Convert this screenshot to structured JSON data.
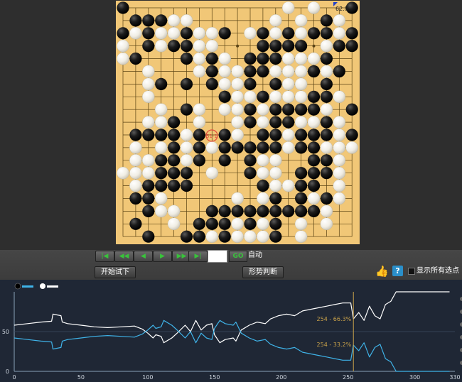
{
  "board": {
    "size": 19,
    "score_badge": "62.8",
    "current_move_marker": "51-1",
    "stones": {
      "black": [
        [
          0,
          0
        ],
        [
          18,
          0
        ],
        [
          1,
          1
        ],
        [
          2,
          1
        ],
        [
          3,
          1
        ],
        [
          16,
          1
        ],
        [
          0,
          2
        ],
        [
          2,
          2
        ],
        [
          5,
          2
        ],
        [
          8,
          2
        ],
        [
          11,
          2
        ],
        [
          13,
          2
        ],
        [
          15,
          2
        ],
        [
          16,
          2
        ],
        [
          18,
          2
        ],
        [
          2,
          3
        ],
        [
          4,
          3
        ],
        [
          5,
          3
        ],
        [
          11,
          3
        ],
        [
          12,
          3
        ],
        [
          13,
          3
        ],
        [
          14,
          3
        ],
        [
          17,
          3
        ],
        [
          18,
          3
        ],
        [
          1,
          4
        ],
        [
          5,
          4
        ],
        [
          7,
          4
        ],
        [
          10,
          4
        ],
        [
          11,
          4
        ],
        [
          12,
          4
        ],
        [
          16,
          4
        ],
        [
          7,
          5
        ],
        [
          10,
          5
        ],
        [
          11,
          5
        ],
        [
          15,
          5
        ],
        [
          17,
          5
        ],
        [
          3,
          6
        ],
        [
          5,
          6
        ],
        [
          7,
          6
        ],
        [
          10,
          6
        ],
        [
          12,
          6
        ],
        [
          16,
          6
        ],
        [
          8,
          7
        ],
        [
          11,
          7
        ],
        [
          15,
          7
        ],
        [
          16,
          7
        ],
        [
          5,
          8
        ],
        [
          10,
          8
        ],
        [
          12,
          8
        ],
        [
          13,
          8
        ],
        [
          14,
          8
        ],
        [
          15,
          8
        ],
        [
          18,
          8
        ],
        [
          4,
          9
        ],
        [
          10,
          9
        ],
        [
          12,
          9
        ],
        [
          13,
          9
        ],
        [
          16,
          9
        ],
        [
          1,
          10
        ],
        [
          2,
          10
        ],
        [
          3,
          10
        ],
        [
          4,
          10
        ],
        [
          6,
          10
        ],
        [
          8,
          10
        ],
        [
          11,
          10
        ],
        [
          12,
          10
        ],
        [
          14,
          10
        ],
        [
          15,
          10
        ],
        [
          16,
          10
        ],
        [
          18,
          10
        ],
        [
          4,
          11
        ],
        [
          6,
          11
        ],
        [
          8,
          11
        ],
        [
          9,
          11
        ],
        [
          10,
          11
        ],
        [
          11,
          11
        ],
        [
          12,
          11
        ],
        [
          14,
          11
        ],
        [
          15,
          11
        ],
        [
          3,
          12
        ],
        [
          4,
          12
        ],
        [
          6,
          12
        ],
        [
          8,
          12
        ],
        [
          10,
          12
        ],
        [
          15,
          12
        ],
        [
          16,
          12
        ],
        [
          3,
          13
        ],
        [
          4,
          13
        ],
        [
          5,
          13
        ],
        [
          10,
          13
        ],
        [
          14,
          13
        ],
        [
          15,
          13
        ],
        [
          16,
          13
        ],
        [
          2,
          14
        ],
        [
          3,
          14
        ],
        [
          4,
          14
        ],
        [
          5,
          14
        ],
        [
          11,
          14
        ],
        [
          14,
          14
        ],
        [
          15,
          14
        ],
        [
          1,
          15
        ],
        [
          2,
          15
        ],
        [
          12,
          15
        ],
        [
          14,
          15
        ],
        [
          16,
          15
        ],
        [
          2,
          16
        ],
        [
          7,
          16
        ],
        [
          8,
          16
        ],
        [
          9,
          16
        ],
        [
          10,
          16
        ],
        [
          11,
          16
        ],
        [
          12,
          16
        ],
        [
          13,
          16
        ],
        [
          14,
          16
        ],
        [
          15,
          16
        ],
        [
          1,
          17
        ],
        [
          6,
          17
        ],
        [
          7,
          17
        ],
        [
          8,
          17
        ],
        [
          10,
          17
        ],
        [
          12,
          17
        ],
        [
          2,
          18
        ],
        [
          5,
          18
        ],
        [
          6,
          18
        ],
        [
          8,
          18
        ],
        [
          12,
          18
        ]
      ],
      "white": [
        [
          13,
          0
        ],
        [
          15,
          0
        ],
        [
          4,
          1
        ],
        [
          5,
          1
        ],
        [
          12,
          1
        ],
        [
          14,
          1
        ],
        [
          17,
          1
        ],
        [
          1,
          2
        ],
        [
          3,
          2
        ],
        [
          4,
          2
        ],
        [
          6,
          2
        ],
        [
          7,
          2
        ],
        [
          10,
          2
        ],
        [
          12,
          2
        ],
        [
          14,
          2
        ],
        [
          17,
          2
        ],
        [
          0,
          3
        ],
        [
          3,
          3
        ],
        [
          6,
          3
        ],
        [
          7,
          3
        ],
        [
          16,
          3
        ],
        [
          0,
          4
        ],
        [
          6,
          4
        ],
        [
          8,
          4
        ],
        [
          13,
          4
        ],
        [
          14,
          4
        ],
        [
          15,
          4
        ],
        [
          2,
          5
        ],
        [
          6,
          5
        ],
        [
          8,
          5
        ],
        [
          9,
          5
        ],
        [
          12,
          5
        ],
        [
          13,
          5
        ],
        [
          14,
          5
        ],
        [
          16,
          5
        ],
        [
          2,
          6
        ],
        [
          8,
          6
        ],
        [
          9,
          6
        ],
        [
          13,
          6
        ],
        [
          14,
          6
        ],
        [
          2,
          7
        ],
        [
          9,
          7
        ],
        [
          10,
          7
        ],
        [
          12,
          7
        ],
        [
          13,
          7
        ],
        [
          14,
          7
        ],
        [
          17,
          7
        ],
        [
          3,
          8
        ],
        [
          6,
          8
        ],
        [
          8,
          8
        ],
        [
          9,
          8
        ],
        [
          11,
          8
        ],
        [
          16,
          8
        ],
        [
          2,
          9
        ],
        [
          3,
          9
        ],
        [
          6,
          9
        ],
        [
          9,
          9
        ],
        [
          11,
          9
        ],
        [
          14,
          9
        ],
        [
          15,
          9
        ],
        [
          17,
          9
        ],
        [
          5,
          10
        ],
        [
          9,
          10
        ],
        [
          13,
          10
        ],
        [
          17,
          10
        ],
        [
          1,
          11
        ],
        [
          3,
          11
        ],
        [
          5,
          11
        ],
        [
          7,
          11
        ],
        [
          13,
          11
        ],
        [
          16,
          11
        ],
        [
          17,
          11
        ],
        [
          18,
          11
        ],
        [
          1,
          12
        ],
        [
          2,
          12
        ],
        [
          5,
          12
        ],
        [
          11,
          12
        ],
        [
          12,
          12
        ],
        [
          17,
          12
        ],
        [
          0,
          13
        ],
        [
          1,
          13
        ],
        [
          2,
          13
        ],
        [
          7,
          13
        ],
        [
          11,
          13
        ],
        [
          12,
          13
        ],
        [
          17,
          13
        ],
        [
          1,
          14
        ],
        [
          12,
          14
        ],
        [
          13,
          14
        ],
        [
          17,
          14
        ],
        [
          3,
          15
        ],
        [
          9,
          15
        ],
        [
          11,
          15
        ],
        [
          15,
          15
        ],
        [
          17,
          15
        ],
        [
          3,
          16
        ],
        [
          4,
          16
        ],
        [
          16,
          16
        ],
        [
          4,
          17
        ],
        [
          9,
          17
        ],
        [
          11,
          17
        ],
        [
          14,
          17
        ],
        [
          16,
          17
        ],
        [
          7,
          18
        ],
        [
          9,
          18
        ],
        [
          10,
          18
        ],
        [
          11,
          18
        ],
        [
          14,
          18
        ]
      ]
    }
  },
  "controls": {
    "nav_buttons": [
      "|◀",
      "◀◀",
      "◀",
      "▶",
      "▶▶",
      "▶|"
    ],
    "move_input_value": "",
    "go_label": "GO",
    "auto_label": "自动",
    "try_label": "开始试下",
    "judge_label": "形势判断",
    "like_icon": "thumbs-up-icon",
    "help_label": "?",
    "show_options_label": "显示所有选点"
  },
  "chart_data": {
    "type": "line",
    "xlim": [
      0,
      330
    ],
    "ylim": [
      0,
      100
    ],
    "xticks": [
      0,
      50,
      100,
      150,
      200,
      250,
      300,
      330
    ],
    "yticks": [
      0,
      50
    ],
    "marker_x": 254,
    "marker_label_white": "254 - 66.3%",
    "marker_label_black": "254 - 33.2%",
    "colors": {
      "white": "#ffffff",
      "black": "#3fb3e8",
      "marker": "#c9a24a"
    },
    "series": [
      {
        "color": "white",
        "points": [
          [
            0,
            58
          ],
          [
            10,
            60
          ],
          [
            20,
            62
          ],
          [
            28,
            63
          ],
          [
            29,
            72
          ],
          [
            35,
            70
          ],
          [
            36,
            62
          ],
          [
            40,
            60
          ],
          [
            50,
            58
          ],
          [
            60,
            56
          ],
          [
            70,
            55
          ],
          [
            80,
            56
          ],
          [
            90,
            57
          ],
          [
            96,
            53
          ],
          [
            100,
            48
          ],
          [
            104,
            42
          ],
          [
            106,
            46
          ],
          [
            110,
            44
          ],
          [
            112,
            36
          ],
          [
            118,
            42
          ],
          [
            122,
            48
          ],
          [
            128,
            58
          ],
          [
            132,
            50
          ],
          [
            136,
            64
          ],
          [
            140,
            52
          ],
          [
            144,
            58
          ],
          [
            148,
            60
          ],
          [
            150,
            46
          ],
          [
            154,
            36
          ],
          [
            158,
            40
          ],
          [
            164,
            42
          ],
          [
            166,
            38
          ],
          [
            170,
            52
          ],
          [
            176,
            58
          ],
          [
            182,
            62
          ],
          [
            188,
            60
          ],
          [
            192,
            66
          ],
          [
            198,
            70
          ],
          [
            204,
            72
          ],
          [
            210,
            70
          ],
          [
            216,
            76
          ],
          [
            222,
            78
          ],
          [
            228,
            80
          ],
          [
            234,
            82
          ],
          [
            240,
            84
          ],
          [
            246,
            86
          ],
          [
            252,
            86
          ],
          [
            254,
            66
          ],
          [
            258,
            74
          ],
          [
            262,
            64
          ],
          [
            266,
            82
          ],
          [
            270,
            70
          ],
          [
            274,
            66
          ],
          [
            278,
            84
          ],
          [
            282,
            88
          ],
          [
            286,
            100
          ],
          [
            296,
            100
          ],
          [
            306,
            100
          ],
          [
            316,
            100
          ],
          [
            326,
            100
          ]
        ]
      },
      {
        "color": "black",
        "points": [
          [
            0,
            42
          ],
          [
            10,
            40
          ],
          [
            20,
            38
          ],
          [
            28,
            37
          ],
          [
            29,
            28
          ],
          [
            35,
            30
          ],
          [
            36,
            38
          ],
          [
            40,
            40
          ],
          [
            50,
            42
          ],
          [
            60,
            44
          ],
          [
            70,
            45
          ],
          [
            80,
            44
          ],
          [
            90,
            43
          ],
          [
            96,
            47
          ],
          [
            100,
            52
          ],
          [
            104,
            58
          ],
          [
            106,
            54
          ],
          [
            110,
            56
          ],
          [
            112,
            64
          ],
          [
            118,
            58
          ],
          [
            122,
            52
          ],
          [
            128,
            42
          ],
          [
            132,
            50
          ],
          [
            136,
            36
          ],
          [
            140,
            48
          ],
          [
            144,
            42
          ],
          [
            148,
            40
          ],
          [
            150,
            54
          ],
          [
            154,
            64
          ],
          [
            158,
            60
          ],
          [
            164,
            58
          ],
          [
            166,
            62
          ],
          [
            170,
            48
          ],
          [
            176,
            42
          ],
          [
            182,
            38
          ],
          [
            188,
            40
          ],
          [
            192,
            34
          ],
          [
            198,
            30
          ],
          [
            204,
            28
          ],
          [
            210,
            30
          ],
          [
            216,
            24
          ],
          [
            222,
            22
          ],
          [
            228,
            20
          ],
          [
            234,
            18
          ],
          [
            240,
            16
          ],
          [
            246,
            14
          ],
          [
            252,
            14
          ],
          [
            254,
            33
          ],
          [
            258,
            26
          ],
          [
            262,
            36
          ],
          [
            266,
            18
          ],
          [
            270,
            30
          ],
          [
            274,
            34
          ],
          [
            278,
            16
          ],
          [
            282,
            12
          ],
          [
            286,
            0
          ],
          [
            296,
            0
          ],
          [
            306,
            0
          ],
          [
            316,
            0
          ],
          [
            326,
            0
          ]
        ]
      }
    ]
  }
}
